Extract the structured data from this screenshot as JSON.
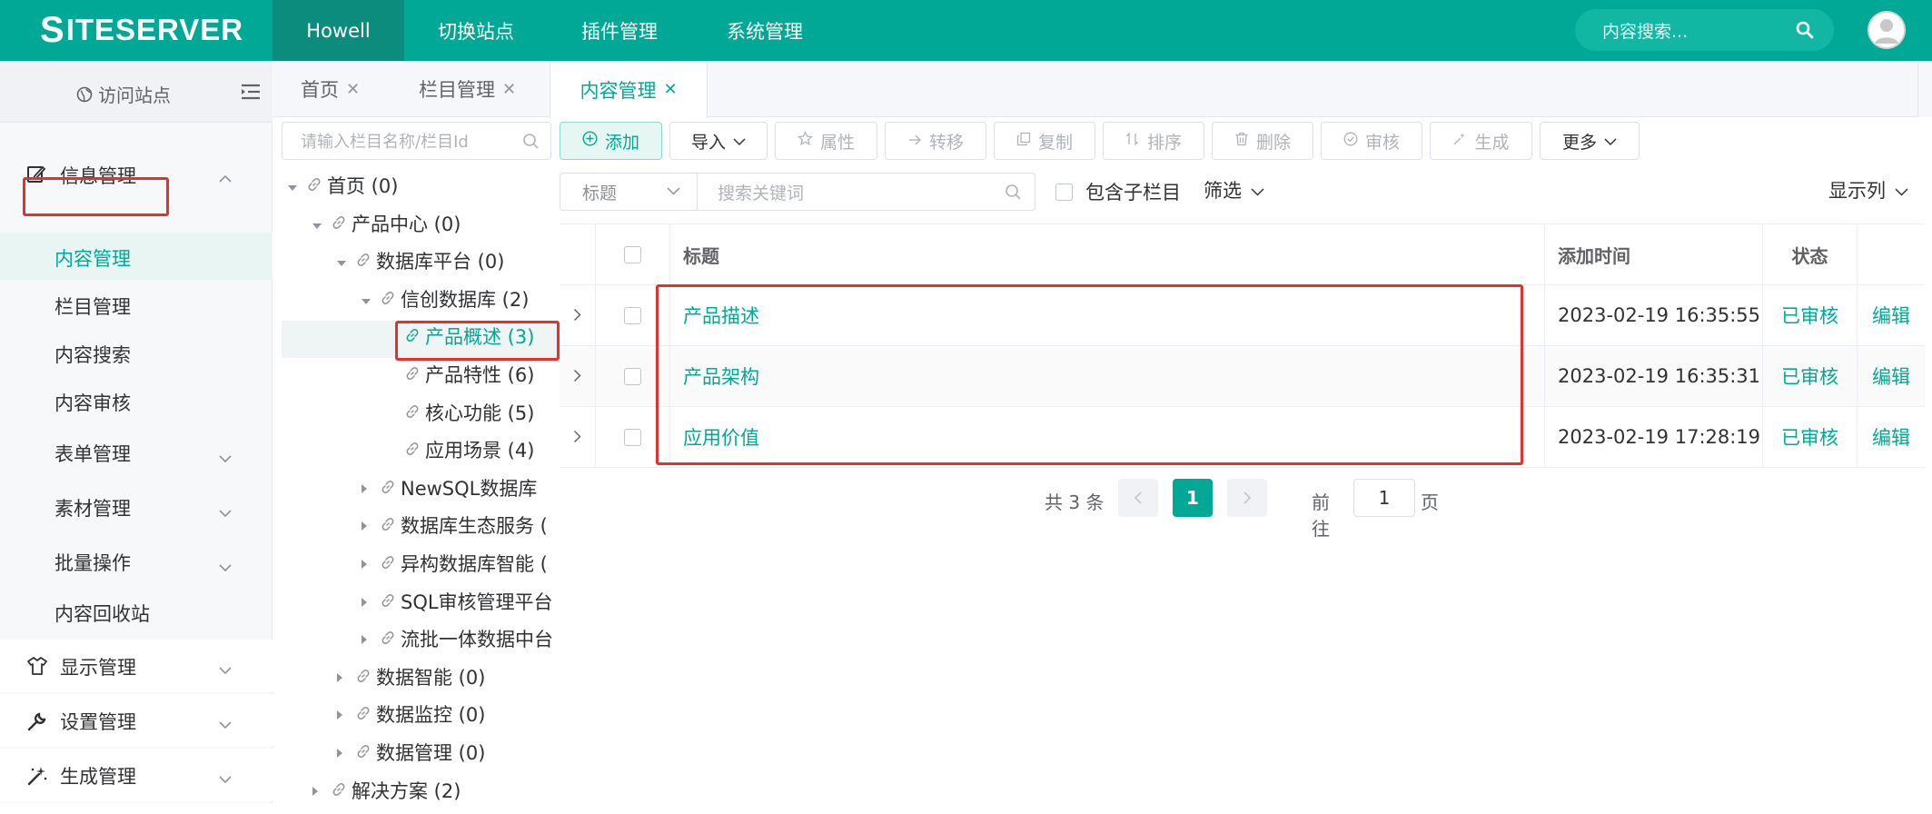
{
  "header": {
    "logo": "SITESERVER",
    "nav": [
      "Howell",
      "切换站点",
      "插件管理",
      "系统管理"
    ],
    "search_placeholder": "内容搜索..."
  },
  "sidebar": {
    "visit_site": "访问站点",
    "groups": {
      "info": "信息管理",
      "display": "显示管理",
      "settings": "设置管理",
      "generate": "生成管理"
    },
    "items": [
      "内容管理",
      "栏目管理",
      "内容搜索",
      "内容审核",
      "表单管理",
      "素材管理",
      "批量操作",
      "内容回收站"
    ]
  },
  "tabs": [
    "首页",
    "栏目管理",
    "内容管理"
  ],
  "tree": {
    "search_placeholder": "请输入栏目名称/栏目Id",
    "nodes": [
      "首页 (0)",
      "产品中心 (0)",
      "数据库平台 (0)",
      "信创数据库 (2)",
      "产品概述 (3)",
      "产品特性 (6)",
      "核心功能 (5)",
      "应用场景 (4)",
      "NewSQL数据库",
      "数据库生态服务 (",
      "异构数据库智能 (",
      "SQL审核管理平台",
      "流批一体数据中台",
      "数据智能 (0)",
      "数据监控 (0)",
      "数据管理 (0)",
      "解决方案 (2)"
    ]
  },
  "toolbar": {
    "add": "添加",
    "import": "导入",
    "attrs": "属性",
    "transfer": "转移",
    "copy": "复制",
    "sort": "排序",
    "delete": "删除",
    "audit": "审核",
    "generate": "生成",
    "more": "更多"
  },
  "filter": {
    "search_type": "标题",
    "keyword_placeholder": "搜索关键词",
    "include_children": "包含子栏目",
    "filter": "筛选",
    "show_columns": "显示列"
  },
  "table": {
    "headers": {
      "title": "标题",
      "added": "添加时间",
      "status": "状态"
    },
    "rows": [
      {
        "title": "产品描述",
        "added": "2023-02-19 16:35:55",
        "status": "已审核",
        "action": "编辑"
      },
      {
        "title": "产品架构",
        "added": "2023-02-19 16:35:31",
        "status": "已审核",
        "action": "编辑"
      },
      {
        "title": "应用价值",
        "added": "2023-02-19 17:28:19",
        "status": "已审核",
        "action": "编辑"
      }
    ]
  },
  "pagination": {
    "total": "共 3 条",
    "current": "1",
    "goto_prefix": "前往",
    "goto_value": "1",
    "goto_suffix": "页"
  },
  "colors": {
    "brand": "#00a895",
    "highlight": "#e62f2f"
  }
}
